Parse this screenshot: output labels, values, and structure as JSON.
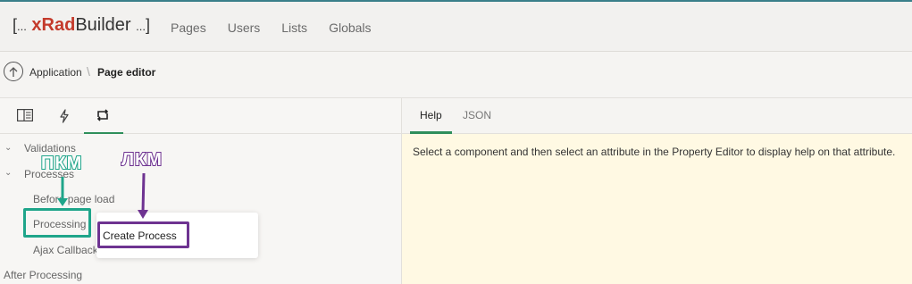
{
  "app": {
    "logo_left": "[",
    "logo_dots_left": "...",
    "logo_x": "xRad",
    "logo_builder": "Builder",
    "logo_dots_right": "...",
    "logo_right": "]"
  },
  "nav": {
    "items": [
      "Pages",
      "Users",
      "Lists",
      "Globals"
    ]
  },
  "breadcrumb": {
    "parent": "Application",
    "separator": "\\",
    "current": "Page editor"
  },
  "left_tabs": {
    "icons": [
      "panel-layout-icon",
      "lightning-icon",
      "loop-arrows-icon"
    ],
    "active_index": 2
  },
  "tree": {
    "validations": "Validations",
    "processes": "Processes",
    "before_page_load": "Before page load",
    "processing": "Processing",
    "ajax_callback": "Ajax Callback",
    "after_processing": "After Processing"
  },
  "context_menu": {
    "create_process": "Create Process"
  },
  "annotations": {
    "right_click": "ПКМ",
    "left_click": "ЛКМ",
    "green": "#1fa58a",
    "purple": "#6e3391"
  },
  "right_tabs": {
    "help": "Help",
    "json": "JSON",
    "active": "Help"
  },
  "help": {
    "text": "Select a component and then select an attribute in the Property Editor to display help on that attribute."
  },
  "colors": {
    "accent": "#2f8f5b",
    "brand_x": "#c43a2b",
    "help_bg": "#fff9e3"
  }
}
